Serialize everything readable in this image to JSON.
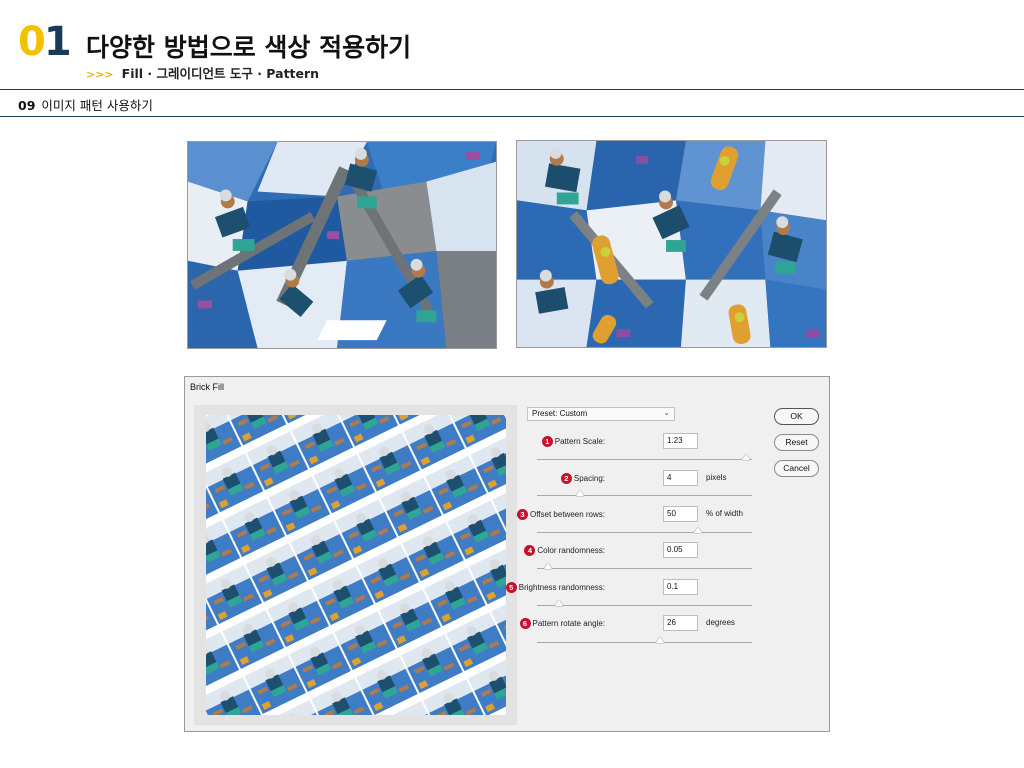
{
  "header": {
    "chapter_num_first": "0",
    "chapter_num_second": "1",
    "title": "다양한 방법으로 색상 적용하기",
    "sub_arrows": ">>>",
    "subtitle": "Fill · 그레이디언트 도구 · Pattern"
  },
  "section": {
    "number": "09",
    "label": "이미지 패턴 사용하기"
  },
  "dialog": {
    "title": "Brick Fill",
    "preset": "Preset: Custom",
    "buttons": {
      "ok": "OK",
      "reset": "Reset",
      "cancel": "Cancel"
    },
    "params": [
      {
        "badge": "1",
        "label": "Pattern Scale:",
        "value": "1.23",
        "unit": "",
        "slider_fraction": 0.97
      },
      {
        "badge": "2",
        "label": "Spacing:",
        "value": "4",
        "unit": "pixels",
        "slider_fraction": 0.2
      },
      {
        "badge": "3",
        "label": "Offset between rows:",
        "value": "50",
        "unit": "% of width",
        "slider_fraction": 0.75
      },
      {
        "badge": "4",
        "label": "Color randomness:",
        "value": "0.05",
        "unit": "",
        "slider_fraction": 0.05
      },
      {
        "badge": "5",
        "label": "Brightness randomness:",
        "value": "0.1",
        "unit": "",
        "slider_fraction": 0.1
      },
      {
        "badge": "6",
        "label": "Pattern rotate angle:",
        "value": "26",
        "unit": "degrees",
        "slider_fraction": 0.57
      }
    ]
  },
  "colors": {
    "accent_yellow": "#f2c200",
    "navy": "#1a3a5a",
    "badge_red": "#c8102e",
    "sky_blue": "#2a6fb8"
  }
}
